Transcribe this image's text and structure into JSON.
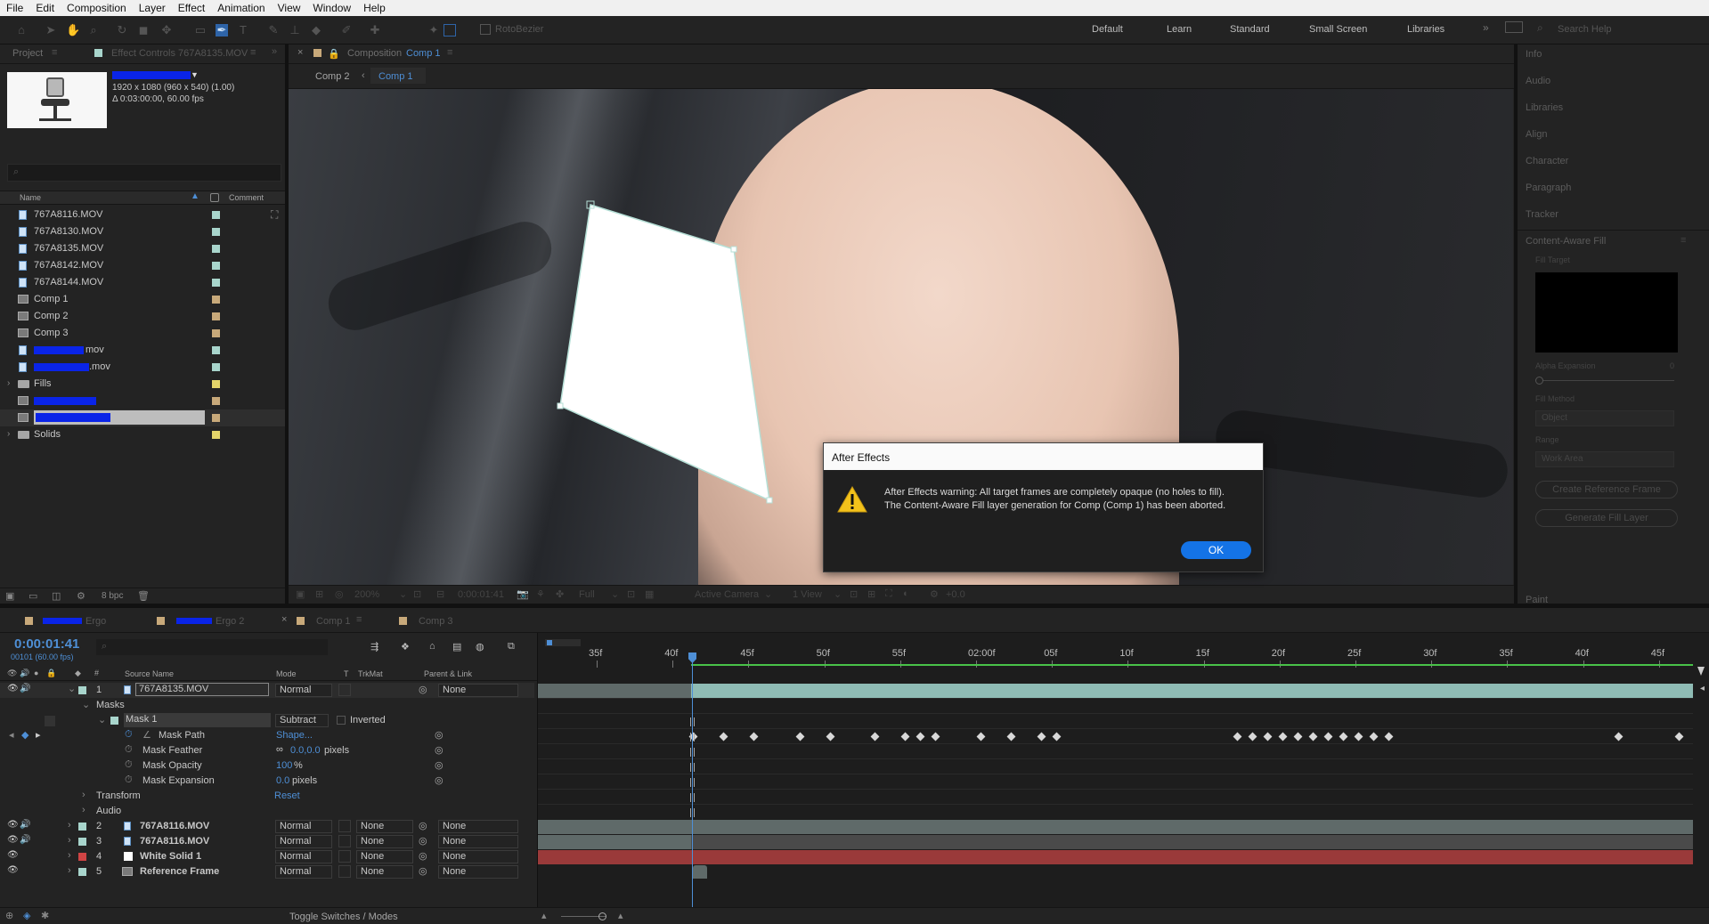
{
  "menu": [
    "File",
    "Edit",
    "Composition",
    "Layer",
    "Effect",
    "Animation",
    "View",
    "Window",
    "Help"
  ],
  "toolbar": {
    "rotobezier": "RotoBezier",
    "workspaces": [
      "Default",
      "Learn",
      "Standard",
      "Small Screen",
      "Libraries"
    ],
    "search_placeholder": "Search Help"
  },
  "project_panel": {
    "tab_project": "Project",
    "tab_effect_controls": "Effect Controls 767A8135.MOV",
    "info_line1": "1920 x 1080  (960 x 540) (1.00)",
    "info_line2": "Δ 0:03:00:00, 60.00 fps",
    "col_name": "Name",
    "col_comment": "Comment",
    "items": [
      {
        "name": "767A8116.MOV",
        "type": "file",
        "color": "#a8d5cc"
      },
      {
        "name": "767A8130.MOV",
        "type": "file",
        "color": "#a8d5cc"
      },
      {
        "name": "767A8135.MOV",
        "type": "file",
        "color": "#a8d5cc"
      },
      {
        "name": "767A8142.MOV",
        "type": "file",
        "color": "#a8d5cc"
      },
      {
        "name": "767A8144.MOV",
        "type": "file",
        "color": "#a8d5cc"
      },
      {
        "name": "Comp 1",
        "type": "comp",
        "color": "#c8a97a"
      },
      {
        "name": "Comp 2",
        "type": "comp",
        "color": "#c8a97a"
      },
      {
        "name": "Comp 3",
        "type": "comp",
        "color": "#c8a97a"
      },
      {
        "name": "mov",
        "type": "file",
        "color": "#a8d5cc"
      },
      {
        "name": ".mov",
        "type": "file",
        "color": "#a8d5cc"
      },
      {
        "name": "Fills",
        "type": "folder",
        "color": "#e3d46a"
      },
      {
        "name": "",
        "type": "comp",
        "color": "#c8a97a"
      },
      {
        "name": "",
        "type": "comp",
        "color": "#c8a97a"
      },
      {
        "name": "Solids",
        "type": "folder",
        "color": "#e3d46a"
      }
    ],
    "bpc": "8 bpc"
  },
  "comp_panel": {
    "tab_label_prefix": "Composition",
    "tab_label_comp": "Comp 1",
    "breadcrumb_1": "Comp 2",
    "breadcrumb_2": "Comp 1",
    "zoom": "200%",
    "timecode": "0:00:01:41",
    "resolution": "Full",
    "camera": "Active Camera",
    "view": "1 View",
    "exposure": "+0.0"
  },
  "dialog": {
    "title": "After Effects",
    "line1": "After Effects warning: All target frames are completely opaque (no holes to fill).",
    "line2": "The Content-Aware Fill layer generation for Comp (Comp 1) has been aborted.",
    "ok": "OK"
  },
  "right_panel": {
    "items": [
      "Info",
      "Audio",
      "Libraries",
      "Align",
      "Character",
      "Paragraph",
      "Tracker"
    ],
    "caf_title": "Content-Aware Fill",
    "fill_target": "Fill Target",
    "alpha_expansion": "Alpha Expansion",
    "alpha_value": "0",
    "fill_method": "Fill Method",
    "fill_method_value": "Object",
    "range": "Range",
    "range_value": "Work Area",
    "create_ref": "Create Reference Frame",
    "generate": "Generate Fill Layer",
    "paint": "Paint"
  },
  "timeline": {
    "tabs": [
      "Ergo",
      "Ergo 2",
      "Comp 1",
      "Comp 3"
    ],
    "timecode": "0:00:01:41",
    "frames": "00101 (60.00 fps)",
    "col_source": "Source Name",
    "col_mode": "Mode",
    "col_t": "T",
    "col_trkmat": "TrkMat",
    "col_parent": "Parent & Link",
    "layer1": {
      "num": "1",
      "name": "767A8135.MOV",
      "mode": "Normal",
      "parent": "None"
    },
    "masks_label": "Masks",
    "mask1": {
      "name": "Mask 1",
      "mode": "Subtract",
      "inverted": "Inverted"
    },
    "mask_props": [
      {
        "name": "Mask Path",
        "value": "Shape..."
      },
      {
        "name": "Mask Feather",
        "value": "0.0,0.0",
        "unit": "pixels"
      },
      {
        "name": "Mask Opacity",
        "value": "100",
        "unit": "%"
      },
      {
        "name": "Mask Expansion",
        "value": "0.0",
        "unit": "pixels"
      }
    ],
    "transform": "Transform",
    "transform_reset": "Reset",
    "audio": "Audio",
    "layers": [
      {
        "num": "2",
        "name": "767A8116.MOV",
        "mode": "Normal",
        "trkmat": "None",
        "parent": "None",
        "color": "#a8d5cc"
      },
      {
        "num": "3",
        "name": "767A8116.MOV",
        "mode": "Normal",
        "trkmat": "None",
        "parent": "None",
        "color": "#a8d5cc"
      },
      {
        "num": "4",
        "name": "White Solid 1",
        "mode": "Normal",
        "trkmat": "None",
        "parent": "None",
        "color": "#d04444"
      },
      {
        "num": "5",
        "name": "Reference Frame",
        "mode": "Normal",
        "trkmat": "None",
        "parent": "None",
        "color": "#a8d5cc"
      }
    ],
    "ruler": [
      "35f",
      "40f",
      "45f",
      "50f",
      "55f",
      "02:00f",
      "05f",
      "10f",
      "15f",
      "20f",
      "25f",
      "30f",
      "35f",
      "40f",
      "45f"
    ],
    "toggle": "Toggle Switches / Modes"
  }
}
